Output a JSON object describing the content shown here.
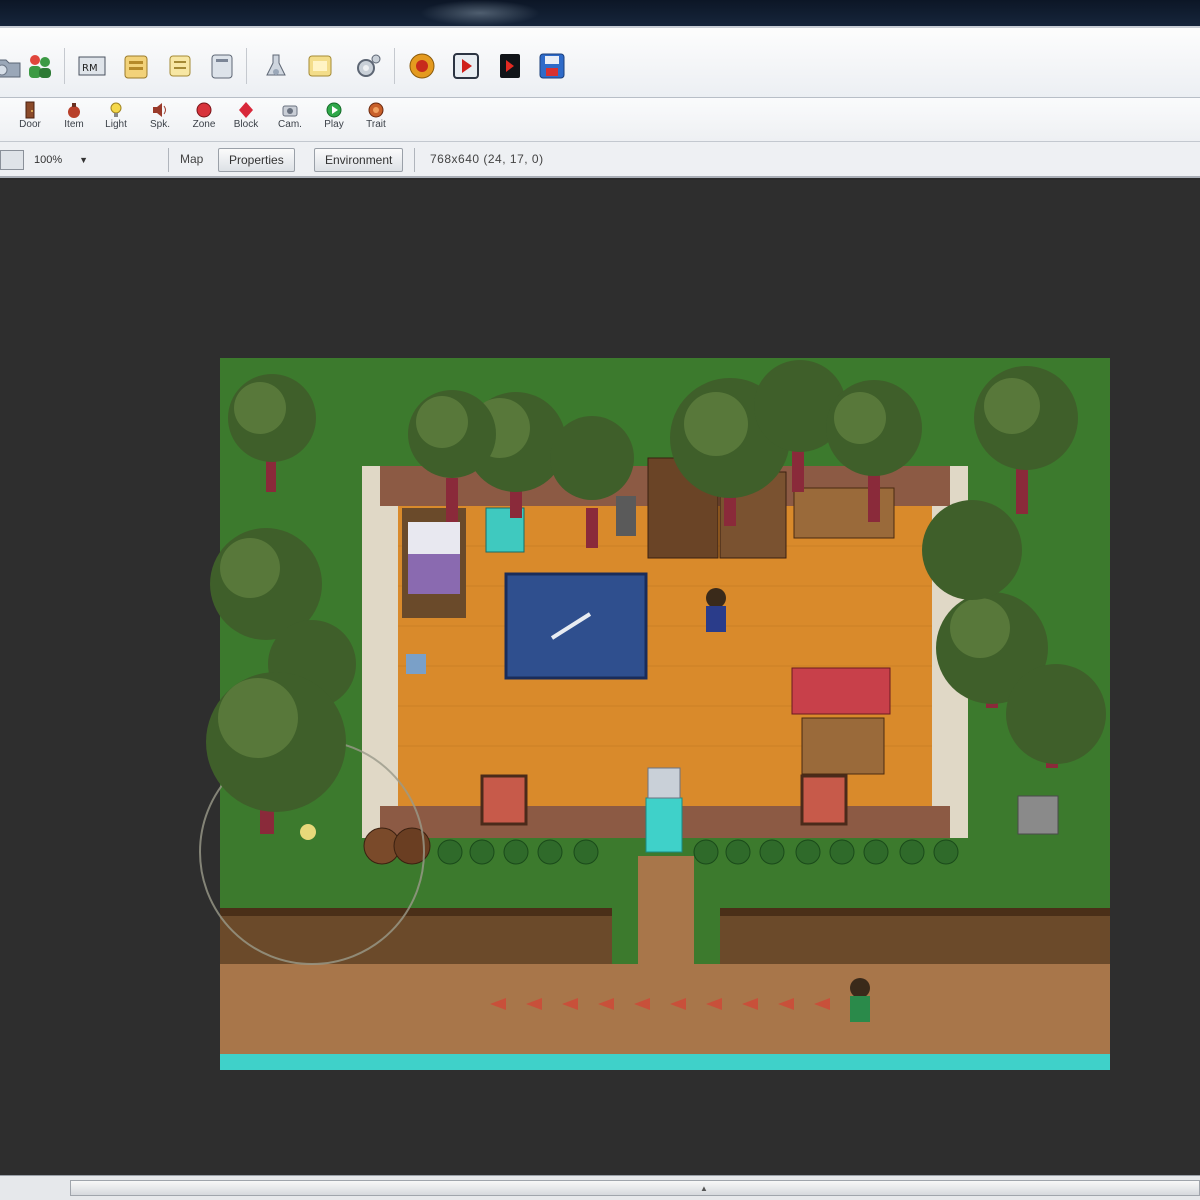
{
  "toolbar_top": {
    "icons": [
      "open-icon",
      "characters-icon",
      "map-icon",
      "database-icon",
      "scroll-icon",
      "script-icon",
      "flask-icon",
      "resource-icon",
      "settings-icon",
      "record-icon",
      "play-icon",
      "stop-icon",
      "save-icon"
    ]
  },
  "tools": [
    {
      "label": "Door",
      "icon": "door-icon"
    },
    {
      "label": "Item",
      "icon": "item-icon"
    },
    {
      "label": "Light",
      "icon": "light-icon"
    },
    {
      "label": "Spk.",
      "icon": "speaker-icon"
    },
    {
      "label": "Zone",
      "icon": "zone-icon"
    },
    {
      "label": "Block",
      "icon": "block-icon"
    },
    {
      "label": "Cam.",
      "icon": "camera-icon"
    },
    {
      "label": "Play",
      "icon": "play-start-icon"
    },
    {
      "label": "Trait",
      "icon": "trait-icon"
    }
  ],
  "zoom": {
    "value": "100%"
  },
  "tabs": {
    "map_label": "Map",
    "properties": "Properties",
    "environment": "Environment"
  },
  "coords": "768x640 (24, 17, 0)",
  "colors": {
    "grass": "#3c7a2d",
    "floor": "#d98a2b",
    "wall_top": "#8c5a44",
    "water": "#3fd1c9",
    "rug": "#2f4f8e",
    "sofa": "#c8404a"
  }
}
